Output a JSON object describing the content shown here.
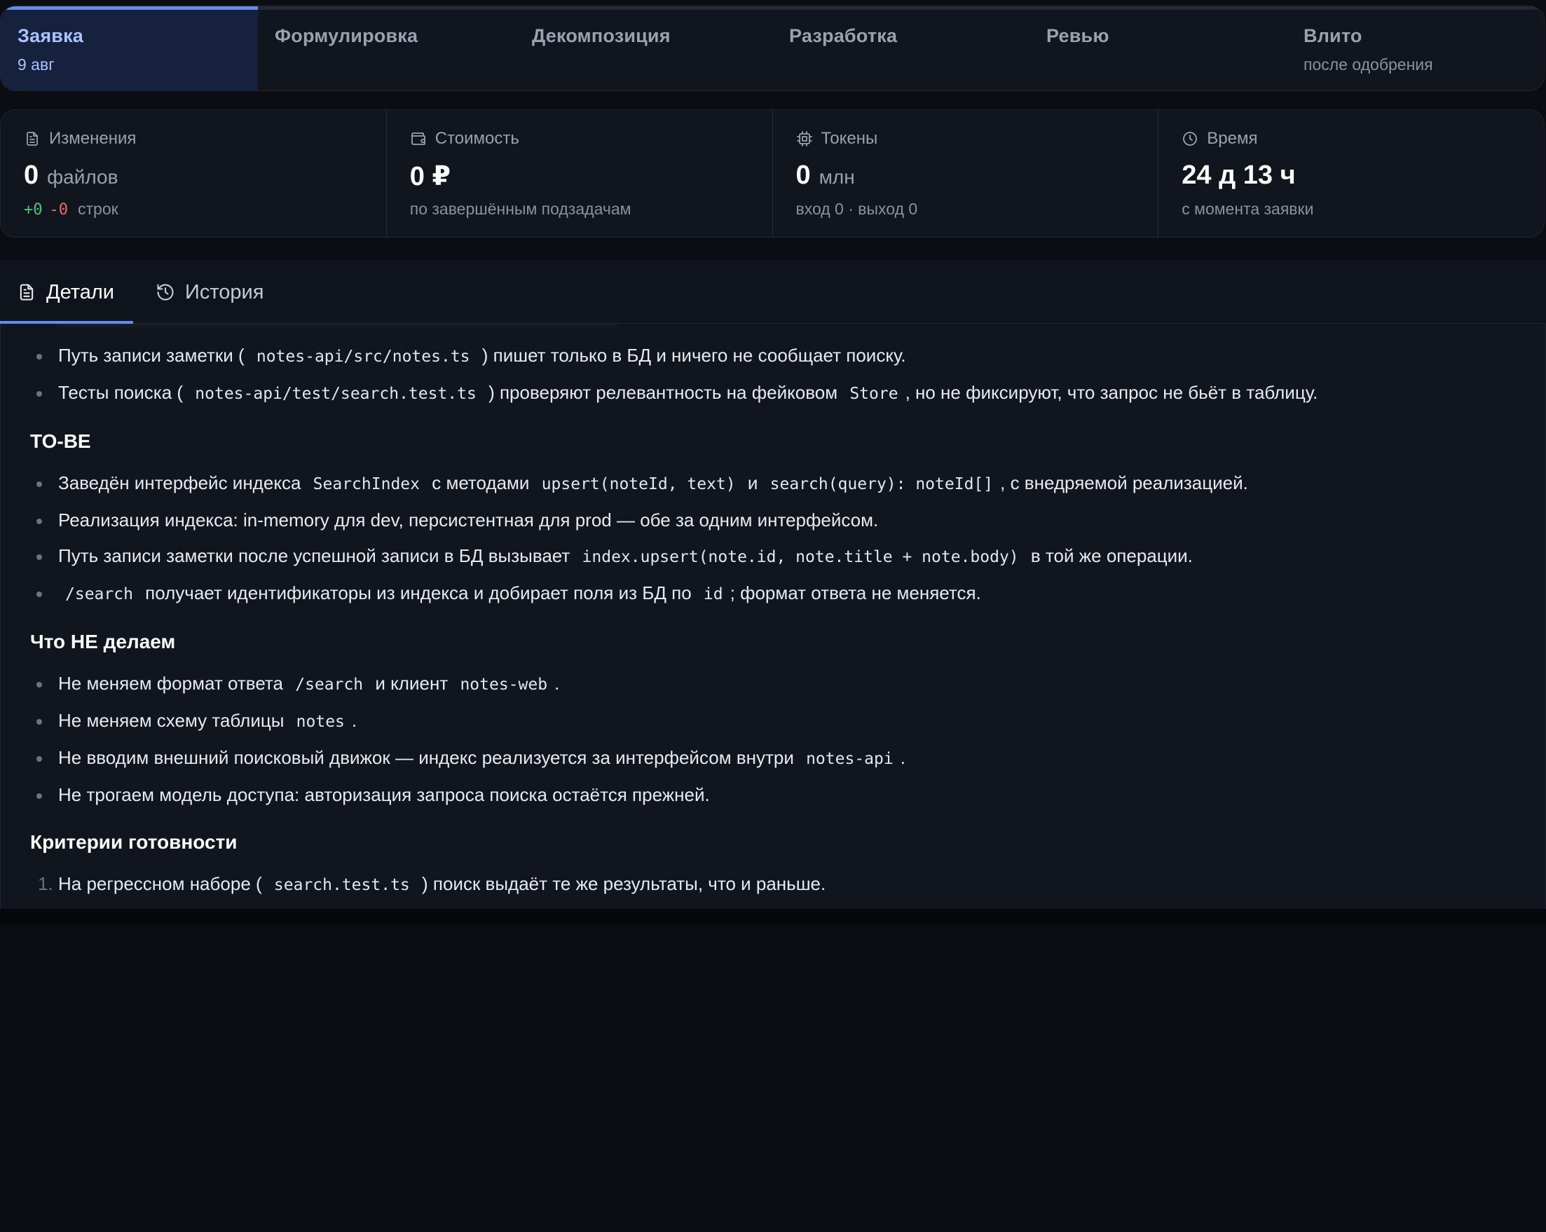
{
  "stages": [
    {
      "name": "Заявка",
      "sub": "9 авг"
    },
    {
      "name": "Формулировка",
      "sub": ""
    },
    {
      "name": "Декомпозиция",
      "sub": ""
    },
    {
      "name": "Разработка",
      "sub": ""
    },
    {
      "name": "Ревью",
      "sub": ""
    },
    {
      "name": "Влито",
      "sub": "после одобрения"
    }
  ],
  "metrics": {
    "changes": {
      "label": "Изменения",
      "value": "0",
      "unit": "файлов",
      "plus": "+0",
      "minus": "-0",
      "lines_label": "строк"
    },
    "cost": {
      "label": "Стоимость",
      "value": "0 ₽",
      "sub": "по завершённым подзадачам"
    },
    "tokens": {
      "label": "Токены",
      "value": "0",
      "unit": "млн",
      "sub": "вход 0 · выход 0"
    },
    "time": {
      "label": "Время",
      "value": "24 д 13 ч",
      "sub": "с момента заявки"
    }
  },
  "tabs": {
    "details": "Детали",
    "history": "История"
  },
  "content": {
    "asis_items": [
      {
        "a": "Путь записи заметки ( ",
        "c1": "notes-api/src/notes.ts",
        "b": " ) пишет только в БД и ничего не сообщает поиску."
      },
      {
        "a": "Тесты поиска ( ",
        "c1": "notes-api/test/search.test.ts",
        "b": " ) проверяют релевантность на фейковом ",
        "c2": "Store",
        "d": ", но не фиксируют, что запрос не бьёт в таблицу."
      }
    ],
    "tobe_title": "TO-BE",
    "tobe_items": [
      {
        "a": "Заведён интерфейс индекса ",
        "c1": "SearchIndex",
        "b": " с методами ",
        "c2": "upsert(noteId, text)",
        "d": " и ",
        "c3": "search(query): noteId[]",
        "e": ", с внедряемой реализацией."
      },
      {
        "a": "Реализация индекса: in-memory для dev, персистентная для prod — обе за одним интерфейсом."
      },
      {
        "a": "Путь записи заметки после успешной записи в БД вызывает ",
        "c1": "index.upsert(note.id, note.title + note.body)",
        "b": " в той же операции."
      },
      {
        "a": "",
        "c1": "/search",
        "b": " получает идентификаторы из индекса и добирает поля из БД по ",
        "c2": "id",
        "d": "; формат ответа не меняется."
      }
    ],
    "notdo_title": "Что НЕ делаем",
    "notdo_items": [
      {
        "a": "Не меняем формат ответа ",
        "c1": "/search",
        "b": " и клиент ",
        "c2": "notes-web",
        "d": "."
      },
      {
        "a": "Не меняем схему таблицы ",
        "c1": "notes",
        "b": "."
      },
      {
        "a": "Не вводим внешний поисковый движок — индекс реализуется за интерфейсом внутри ",
        "c1": "notes-api",
        "b": "."
      },
      {
        "a": "Не трогаем модель доступа: авторизация запроса поиска остаётся прежней."
      }
    ],
    "criteria_title": "Критерии готовности",
    "criteria_items": [
      {
        "n": "1.",
        "a": "На регрессном наборе ( ",
        "c1": "search.test.ts",
        "b": " ) поиск выдаёт те же результаты, что и раньше."
      }
    ]
  },
  "colors": {
    "accent": "#5f8df2",
    "plus": "#4fc27a",
    "minus": "#f2676b",
    "panel": "#11151d"
  }
}
